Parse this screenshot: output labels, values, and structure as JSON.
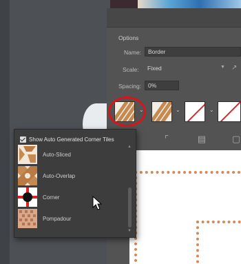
{
  "panel": {
    "section_title": "Options",
    "name_label": "Name:",
    "name_value": "Border",
    "scale_label": "Scale:",
    "scale_value": "Fixed",
    "spacing_label": "Spacing:",
    "spacing_value": "0%"
  },
  "swatches": {
    "selected_icon": "diagonal-stripe-tile",
    "second_icon": "diagonal-stripe-tile",
    "third_icon": "none-tile",
    "fourth_icon": "none-tile",
    "chevron_icon": "chevron-down-icon"
  },
  "tile_buttons": [
    "tile-tool-icon",
    "tile-tool-icon",
    "tile-tool-icon"
  ],
  "dropdown": {
    "checkbox_label": "Show Auto Generated Corner Tiles",
    "checkbox_checked": true,
    "items": [
      {
        "label": "Auto-Sliced"
      },
      {
        "label": "Auto-Overlap"
      },
      {
        "label": "Corner"
      },
      {
        "label": "Pompadour"
      }
    ]
  },
  "colors": {
    "accent_highlight": "#d6161a",
    "tile_brown": "#c58a52",
    "none_slash": "#d92626"
  }
}
